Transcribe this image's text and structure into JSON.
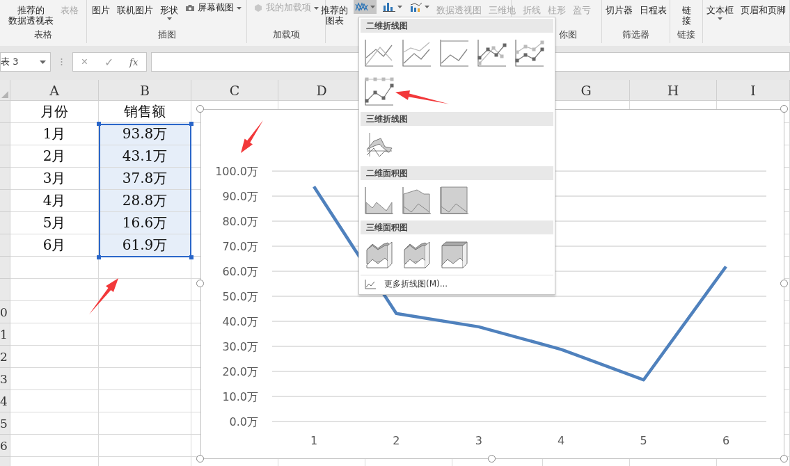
{
  "ribbon": {
    "groups": [
      {
        "label": "表格",
        "buttons": [
          {
            "kind": "large",
            "lines": [
              "推荐的",
              "数据透视表"
            ],
            "disabled": false
          },
          {
            "kind": "large",
            "lines": [
              "表格"
            ],
            "disabled": true
          }
        ]
      },
      {
        "label": "插图",
        "buttons": [
          {
            "kind": "large",
            "lines": [
              "图片"
            ],
            "disabled": false
          },
          {
            "kind": "large",
            "lines": [
              "联机图片"
            ],
            "disabled": false
          },
          {
            "kind": "dropdown",
            "lines": [
              "形状"
            ],
            "disabled": false
          },
          {
            "kind": "small",
            "lines": [
              "屏幕截图"
            ],
            "disabled": false
          }
        ]
      },
      {
        "label": "加载项",
        "buttons": [
          {
            "kind": "small",
            "lines": [
              "我的加载项"
            ],
            "disabled": true
          }
        ]
      },
      {
        "buttons": [
          {
            "kind": "large",
            "lines": [
              "推荐的",
              "图表"
            ],
            "disabled": false
          },
          {
            "kind": "chart-type",
            "expanded": true
          },
          {
            "kind": "chart-type",
            "expanded": false
          },
          {
            "kind": "chart-type",
            "expanded": false
          },
          {
            "kind": "large",
            "lines": [
              "数据透视图"
            ],
            "disabled": true
          },
          {
            "kind": "large",
            "lines": [
              "三维地"
            ],
            "disabled": true
          }
        ]
      },
      {
        "label": "你图",
        "buttons": [
          {
            "kind": "large",
            "lines": [
              "折线"
            ],
            "disabled": true
          },
          {
            "kind": "large",
            "lines": [
              "柱形"
            ],
            "disabled": true
          },
          {
            "kind": "large",
            "lines": [
              "盈亏"
            ],
            "disabled": true
          }
        ]
      },
      {
        "label": "筛选器",
        "buttons": [
          {
            "kind": "large",
            "lines": [
              "切片器"
            ],
            "disabled": false
          },
          {
            "kind": "large",
            "lines": [
              "日程表"
            ],
            "disabled": false
          }
        ]
      },
      {
        "label": "链接",
        "buttons": [
          {
            "kind": "large",
            "lines": [
              "链",
              "接"
            ],
            "disabled": false
          }
        ]
      },
      {
        "buttons": [
          {
            "kind": "dropdown",
            "lines": [
              "文本框"
            ],
            "disabled": false
          },
          {
            "kind": "large",
            "lines": [
              "页眉和页脚"
            ],
            "disabled": false
          }
        ]
      }
    ]
  },
  "formula_bar": {
    "name_box": "表 3",
    "cancel": "×",
    "enter": "✓",
    "function": "fx"
  },
  "sheet": {
    "columns": [
      {
        "label": "A"
      },
      {
        "label": "B"
      },
      {
        "label": "C"
      },
      {
        "label": "D"
      },
      {
        "label": "G"
      },
      {
        "label": "H"
      },
      {
        "label": "I"
      }
    ],
    "rows": [
      {
        "cells": [
          "月份",
          "销售额"
        ],
        "selected": false
      },
      {
        "cells": [
          "1月",
          "93.8万"
        ],
        "selected": true
      },
      {
        "cells": [
          "2月",
          "43.1万"
        ],
        "selected": true
      },
      {
        "cells": [
          "3月",
          "37.8万"
        ],
        "selected": true
      },
      {
        "cells": [
          "4月",
          "28.8万"
        ],
        "selected": true
      },
      {
        "cells": [
          "5月",
          "16.6万"
        ],
        "selected": true
      },
      {
        "cells": [
          "6月",
          "61.9万"
        ],
        "selected": true
      }
    ],
    "row_numbers": [
      "0",
      "1",
      "2",
      "3",
      "4",
      "5",
      "6"
    ]
  },
  "chart": {
    "chart_data": {
      "type": "line",
      "grid": true,
      "categories": [
        "1",
        "2",
        "3",
        "4",
        "5",
        "6"
      ],
      "series": [
        {
          "color": "#4f81bd",
          "values": [
            93.8,
            43.1,
            37.8,
            28.8,
            16.6,
            61.9
          ]
        }
      ],
      "ylim": [
        0,
        100
      ],
      "yticks": [
        {
          "value": 0,
          "label": "0.0万"
        },
        {
          "value": 10,
          "label": "10.0万"
        },
        {
          "value": 20,
          "label": "20.0万"
        },
        {
          "value": 30,
          "label": "30.0万"
        },
        {
          "value": 40,
          "label": "40.0万"
        },
        {
          "value": 50,
          "label": "50.0万"
        },
        {
          "value": 60,
          "label": "60.0万"
        },
        {
          "value": 70,
          "label": "70.0万"
        },
        {
          "value": 80,
          "label": "80.0万"
        },
        {
          "value": 90,
          "label": "90.0万"
        },
        {
          "value": 100,
          "label": "100.0万"
        }
      ]
    }
  },
  "chart_menu": {
    "sections": [
      {
        "title": "二维折线图"
      },
      {
        "title": "三维折线图"
      },
      {
        "title": "二维面积图"
      },
      {
        "title": "三维面积图"
      }
    ],
    "more": "更多折线图(M)..."
  }
}
